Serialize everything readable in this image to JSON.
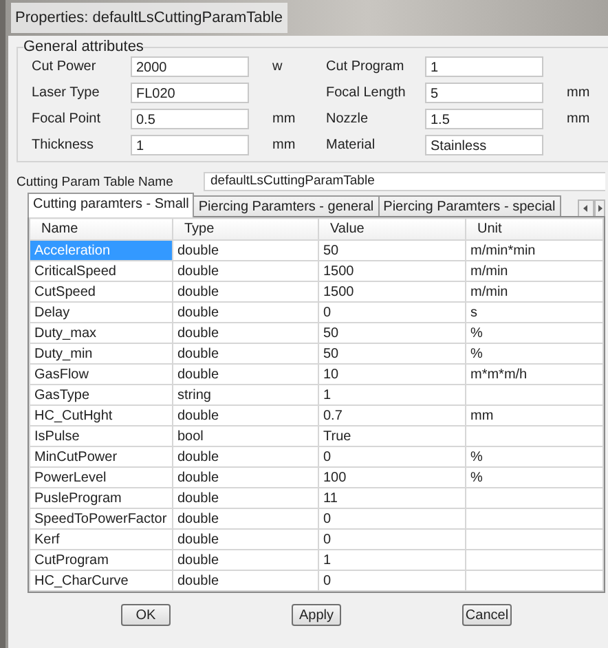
{
  "window": {
    "title": "Properties: defaultLsCuttingParamTable"
  },
  "general_attributes": {
    "title": "General attributes",
    "rows": [
      {
        "left": {
          "label": "Cut Power",
          "value": "2000",
          "unit": "w"
        },
        "right": {
          "label": "Cut Program",
          "value": "1"
        }
      },
      {
        "left": {
          "label": "Laser Type",
          "value": "FL020"
        },
        "right": {
          "label": "Focal Length",
          "value": "5",
          "unit": "mm"
        }
      },
      {
        "left": {
          "label": "Focal Point",
          "value": "0.5",
          "unit": "mm"
        },
        "right": {
          "label": "Nozzle",
          "value": "1.5",
          "unit": "mm"
        }
      },
      {
        "left": {
          "label": "Thickness",
          "value": "1",
          "unit": "mm"
        },
        "right": {
          "label": "Material",
          "value": "Stainless"
        }
      }
    ]
  },
  "table_name": {
    "label": "Cutting Param Table Name",
    "value": "defaultLsCuttingParamTable"
  },
  "tabs": [
    {
      "label": "Cutting paramters - Small",
      "selected": true
    },
    {
      "label": "Piercing Paramters - general",
      "selected": false
    },
    {
      "label": "Piercing Paramters - special",
      "selected": false
    }
  ],
  "grid": {
    "columns": [
      "Name",
      "Type",
      "Value",
      "Unit"
    ],
    "rows": [
      {
        "cells": [
          "Acceleration",
          "double",
          "50",
          "m/min*min"
        ],
        "selected": true
      },
      {
        "cells": [
          "CriticalSpeed",
          "double",
          "1500",
          "m/min"
        ],
        "selected": false
      },
      {
        "cells": [
          "CutSpeed",
          "double",
          "1500",
          "m/min"
        ],
        "selected": false
      },
      {
        "cells": [
          "Delay",
          "double",
          "0",
          "s"
        ],
        "selected": false
      },
      {
        "cells": [
          "Duty_max",
          "double",
          "50",
          "%"
        ],
        "selected": false
      },
      {
        "cells": [
          "Duty_min",
          "double",
          "50",
          "%"
        ],
        "selected": false
      },
      {
        "cells": [
          "GasFlow",
          "double",
          "10",
          "m*m*m/h"
        ],
        "selected": false
      },
      {
        "cells": [
          "GasType",
          "string",
          "1",
          ""
        ],
        "selected": false
      },
      {
        "cells": [
          "HC_CutHght",
          "double",
          "0.7",
          "mm"
        ],
        "selected": false
      },
      {
        "cells": [
          "IsPulse",
          "bool",
          "True",
          ""
        ],
        "selected": false
      },
      {
        "cells": [
          "MinCutPower",
          "double",
          "0",
          "%"
        ],
        "selected": false
      },
      {
        "cells": [
          "PowerLevel",
          "double",
          "100",
          "%"
        ],
        "selected": false
      },
      {
        "cells": [
          "PusleProgram",
          "double",
          "11",
          ""
        ],
        "selected": false
      },
      {
        "cells": [
          "SpeedToPowerFactor",
          "double",
          "0",
          ""
        ],
        "selected": false
      },
      {
        "cells": [
          "Kerf",
          "double",
          "0",
          ""
        ],
        "selected": false
      },
      {
        "cells": [
          "CutProgram",
          "double",
          "1",
          ""
        ],
        "selected": false
      },
      {
        "cells": [
          "HC_CharCurve",
          "double",
          "0",
          ""
        ],
        "selected": false
      }
    ]
  },
  "buttons": [
    "OK",
    "Apply",
    "Cancel"
  ]
}
